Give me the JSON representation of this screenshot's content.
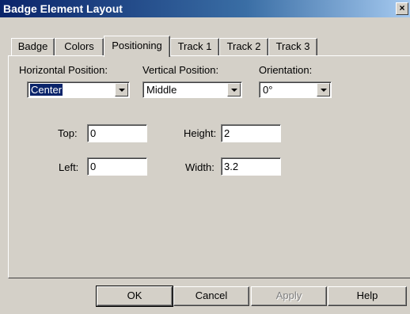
{
  "window": {
    "title": "Badge Element Layout",
    "close_label": "×"
  },
  "tabs": [
    {
      "label": "Badge",
      "active": false
    },
    {
      "label": "Colors",
      "active": false
    },
    {
      "label": "Positioning",
      "active": true
    },
    {
      "label": "Track 1",
      "active": false
    },
    {
      "label": "Track 2",
      "active": false
    },
    {
      "label": "Track 3",
      "active": false
    }
  ],
  "positioning": {
    "horizontal": {
      "label": "Horizontal Position:",
      "value": "Center"
    },
    "vertical": {
      "label": "Vertical Position:",
      "value": "Middle"
    },
    "orientation": {
      "label": "Orientation:",
      "value": "0°"
    },
    "top": {
      "label": "Top:",
      "value": "0"
    },
    "left": {
      "label": "Left:",
      "value": "0"
    },
    "height": {
      "label": "Height:",
      "value": "2"
    },
    "width": {
      "label": "Width:",
      "value": "3.2"
    }
  },
  "buttons": {
    "ok": "OK",
    "cancel": "Cancel",
    "apply": "Apply",
    "help": "Help"
  }
}
